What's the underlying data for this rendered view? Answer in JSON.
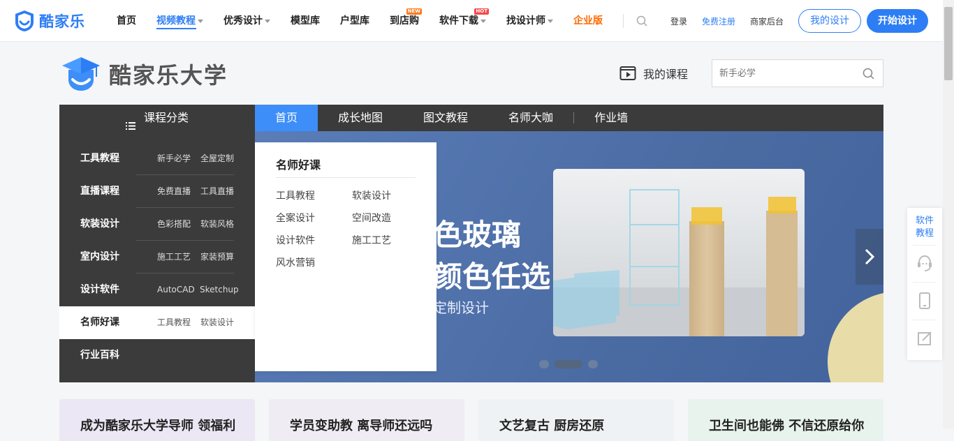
{
  "brand": {
    "name": "酷家乐",
    "color": "#2d7ef5"
  },
  "nav": {
    "items": [
      {
        "label": "首页"
      },
      {
        "label": "视频教程"
      },
      {
        "label": "优秀设计"
      },
      {
        "label": "模型库"
      },
      {
        "label": "户型库"
      },
      {
        "label": "到店购",
        "badge": "NEW"
      },
      {
        "label": "软件下载",
        "badge": "HOT"
      },
      {
        "label": "找设计师"
      },
      {
        "label": "企业版"
      }
    ],
    "login": "登录",
    "register": "免费注册",
    "merchant": "商家后台",
    "my_design": "我的设计",
    "start_design": "开始设计"
  },
  "university": {
    "title": "酷家乐大学",
    "my_courses": "我的课程",
    "search_placeholder": "新手必学"
  },
  "category": {
    "header": "课程分类",
    "rows": [
      {
        "name": "工具教程",
        "subs": [
          "新手必学",
          "全屋定制"
        ]
      },
      {
        "name": "直播课程",
        "subs": [
          "免费直播",
          "工具直播"
        ]
      },
      {
        "name": "软装设计",
        "subs": [
          "色彩搭配",
          "软装风格"
        ]
      },
      {
        "name": "室内设计",
        "subs": [
          "施工工艺",
          "家装预算"
        ]
      },
      {
        "name": "设计软件",
        "subs": [
          "AutoCAD",
          "Sketchup"
        ]
      },
      {
        "name": "名师好课",
        "subs": [
          "工具教程",
          "软装设计"
        ]
      },
      {
        "name": "行业百科",
        "subs": []
      }
    ]
  },
  "tabs": [
    "首页",
    "成长地图",
    "图文教程",
    "名师大咖",
    "作业墙"
  ],
  "dropdown": {
    "title": "名师好课",
    "items": [
      "工具教程",
      "软装设计",
      "全案设计",
      "空间改造",
      "设计软件",
      "施工工艺",
      "风水营销"
    ]
  },
  "banner": {
    "line1": "色玻璃",
    "line2": "颜色任选",
    "line3": "定制设计"
  },
  "float_sidebar": {
    "label1": "软件",
    "label2": "教程"
  },
  "cards": [
    "成为酷家乐大学导师 领福利",
    "学员变助教 离导师还远吗",
    "文艺复古 厨房还原",
    "卫生间也能佛 不信还原给你"
  ]
}
